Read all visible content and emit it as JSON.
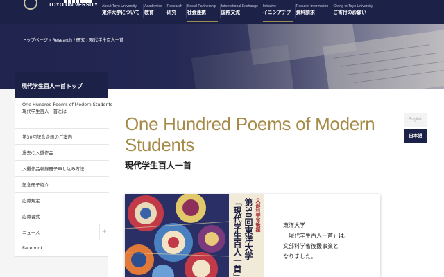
{
  "header": {
    "logo_en": "TOYO UNIVERSITY",
    "nav": [
      {
        "en": "About Toyo University",
        "jp": "東洋大学について"
      },
      {
        "en": "Academics",
        "jp": "教育"
      },
      {
        "en": "Research",
        "jp": "研究"
      },
      {
        "en": "Social Partnership",
        "jp": "社会連携"
      },
      {
        "en": "International Exchange",
        "jp": "国際交流"
      },
      {
        "en": "Initiative",
        "jp": "イニシアチブ"
      },
      {
        "en": "Request Information",
        "jp": "資料請求"
      },
      {
        "en": "Giving to Toyo University",
        "jp": "ご寄付のお願い"
      }
    ]
  },
  "breadcrumb": [
    "トップページ",
    "Research / 研究",
    "現代学生百人一首"
  ],
  "sidebar": {
    "title": "現代学生百人一首トップ",
    "items": [
      {
        "label_en": "One Hundred Poems of Modern Students",
        "label": "現代学生百人一首とは"
      },
      {
        "label": "第30回記念企画のご案内"
      },
      {
        "label": "過去の入選作品"
      },
      {
        "label": "入選作品収録冊子申し込み方法"
      },
      {
        "label": "記念冊子紹介"
      },
      {
        "label": "応募規定"
      },
      {
        "label": "応募書式"
      },
      {
        "label": "ニュース"
      },
      {
        "label": "Facebook"
      }
    ]
  },
  "main": {
    "title_en": "One Hundred Poems of Modern Students",
    "title_jp": "現代学生百人一首",
    "lang_en": "English",
    "lang_jp": "日本語",
    "poster_texts": [
      "文部科学省後援",
      "第30回東洋大学",
      "「現代学生百人一首」"
    ],
    "card_lines": [
      "東洋大学",
      "「現代学生百人一首」は、",
      "文部科学省後援事業と",
      "なりました。"
    ]
  },
  "colors": {
    "navy": "#1c2147",
    "gold": "#a58b47"
  }
}
